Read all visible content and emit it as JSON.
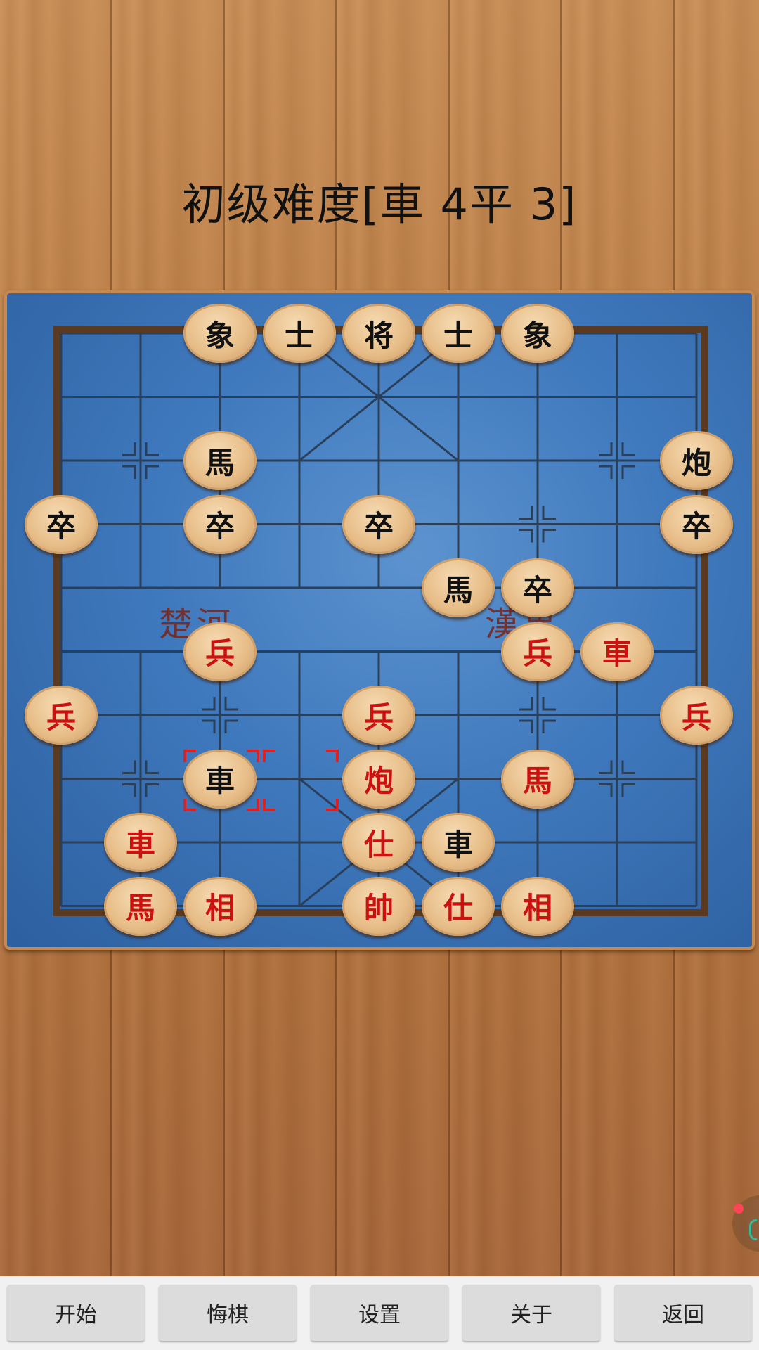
{
  "title": "初级难度[車 4平 3]",
  "river": {
    "left": "楚河",
    "right": "漢界"
  },
  "pieces": [
    {
      "c": "象",
      "s": "black",
      "col": 2,
      "row": 0
    },
    {
      "c": "士",
      "s": "black",
      "col": 3,
      "row": 0
    },
    {
      "c": "将",
      "s": "black",
      "col": 4,
      "row": 0
    },
    {
      "c": "士",
      "s": "black",
      "col": 5,
      "row": 0
    },
    {
      "c": "象",
      "s": "black",
      "col": 6,
      "row": 0
    },
    {
      "c": "馬",
      "s": "black",
      "col": 2,
      "row": 2
    },
    {
      "c": "炮",
      "s": "black",
      "col": 8,
      "row": 2
    },
    {
      "c": "卒",
      "s": "black",
      "col": 0,
      "row": 3
    },
    {
      "c": "卒",
      "s": "black",
      "col": 2,
      "row": 3
    },
    {
      "c": "卒",
      "s": "black",
      "col": 4,
      "row": 3
    },
    {
      "c": "卒",
      "s": "black",
      "col": 8,
      "row": 3
    },
    {
      "c": "馬",
      "s": "black",
      "col": 5,
      "row": 4
    },
    {
      "c": "卒",
      "s": "black",
      "col": 6,
      "row": 4
    },
    {
      "c": "兵",
      "s": "red",
      "col": 2,
      "row": 5
    },
    {
      "c": "兵",
      "s": "red",
      "col": 6,
      "row": 5
    },
    {
      "c": "車",
      "s": "red",
      "col": 7,
      "row": 5
    },
    {
      "c": "兵",
      "s": "red",
      "col": 0,
      "row": 6
    },
    {
      "c": "兵",
      "s": "red",
      "col": 4,
      "row": 6
    },
    {
      "c": "兵",
      "s": "red",
      "col": 8,
      "row": 6
    },
    {
      "c": "車",
      "s": "black",
      "col": 2,
      "row": 7
    },
    {
      "c": "炮",
      "s": "red",
      "col": 4,
      "row": 7
    },
    {
      "c": "馬",
      "s": "red",
      "col": 6,
      "row": 7
    },
    {
      "c": "車",
      "s": "red",
      "col": 1,
      "row": 8
    },
    {
      "c": "仕",
      "s": "red",
      "col": 4,
      "row": 8
    },
    {
      "c": "車",
      "s": "black",
      "col": 5,
      "row": 8
    },
    {
      "c": "馬",
      "s": "red",
      "col": 1,
      "row": 9
    },
    {
      "c": "相",
      "s": "red",
      "col": 2,
      "row": 9
    },
    {
      "c": "帥",
      "s": "red",
      "col": 4,
      "row": 9
    },
    {
      "c": "仕",
      "s": "red",
      "col": 5,
      "row": 9
    },
    {
      "c": "相",
      "s": "red",
      "col": 6,
      "row": 9
    }
  ],
  "last_move": {
    "from_col": 3,
    "to_col": 2,
    "row": 7
  },
  "toolbar": {
    "start": "开始",
    "undo": "悔棋",
    "settings": "设置",
    "about": "关于",
    "back": "返回"
  },
  "colors": {
    "red_piece": "#cc1111",
    "black_piece": "#111111",
    "board": "#3f79bd"
  }
}
